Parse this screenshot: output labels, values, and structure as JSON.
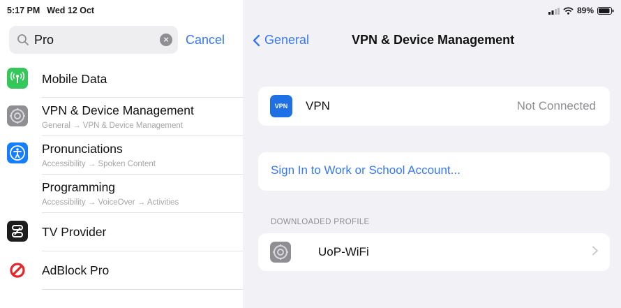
{
  "status": {
    "time": "5:17 PM",
    "date": "Wed 12 Oct",
    "battery": "89%"
  },
  "search": {
    "value": "Pro",
    "cancel_label": "Cancel"
  },
  "results": [
    {
      "title": "Mobile Data",
      "subtitle": "",
      "icon": "antenna-icon",
      "color": "#34c759"
    },
    {
      "title": "VPN & Device Management",
      "subtitle": "General → VPN & Device Management",
      "icon": "gear-icon",
      "color": "#8e8e93"
    },
    {
      "title": "Pronunciations",
      "subtitle": "Accessibility → Spoken Content",
      "icon": "accessibility-icon",
      "color": "#147efb"
    },
    {
      "title": "Programming",
      "subtitle": "Accessibility → VoiceOver → Activities",
      "icon": "",
      "color": ""
    },
    {
      "title": "TV Provider",
      "subtitle": "",
      "icon": "tv-provider-icon",
      "color": "#1c1c1e"
    },
    {
      "title": "AdBlock Pro",
      "subtitle": "",
      "icon": "adblock-icon",
      "color": "#e5262b"
    }
  ],
  "detail": {
    "back_label": "General",
    "title": "VPN & Device Management",
    "vpn": {
      "icon_text": "VPN",
      "label": "VPN",
      "value": "Not Connected"
    },
    "sign_in_label": "Sign In to Work or School Account...",
    "downloaded_profile_header": "DOWNLOADED PROFILE",
    "profile_name": "UoP-WiFi"
  },
  "colors": {
    "accent": "#3478f6",
    "background_grouped": "#f2f2f6"
  }
}
